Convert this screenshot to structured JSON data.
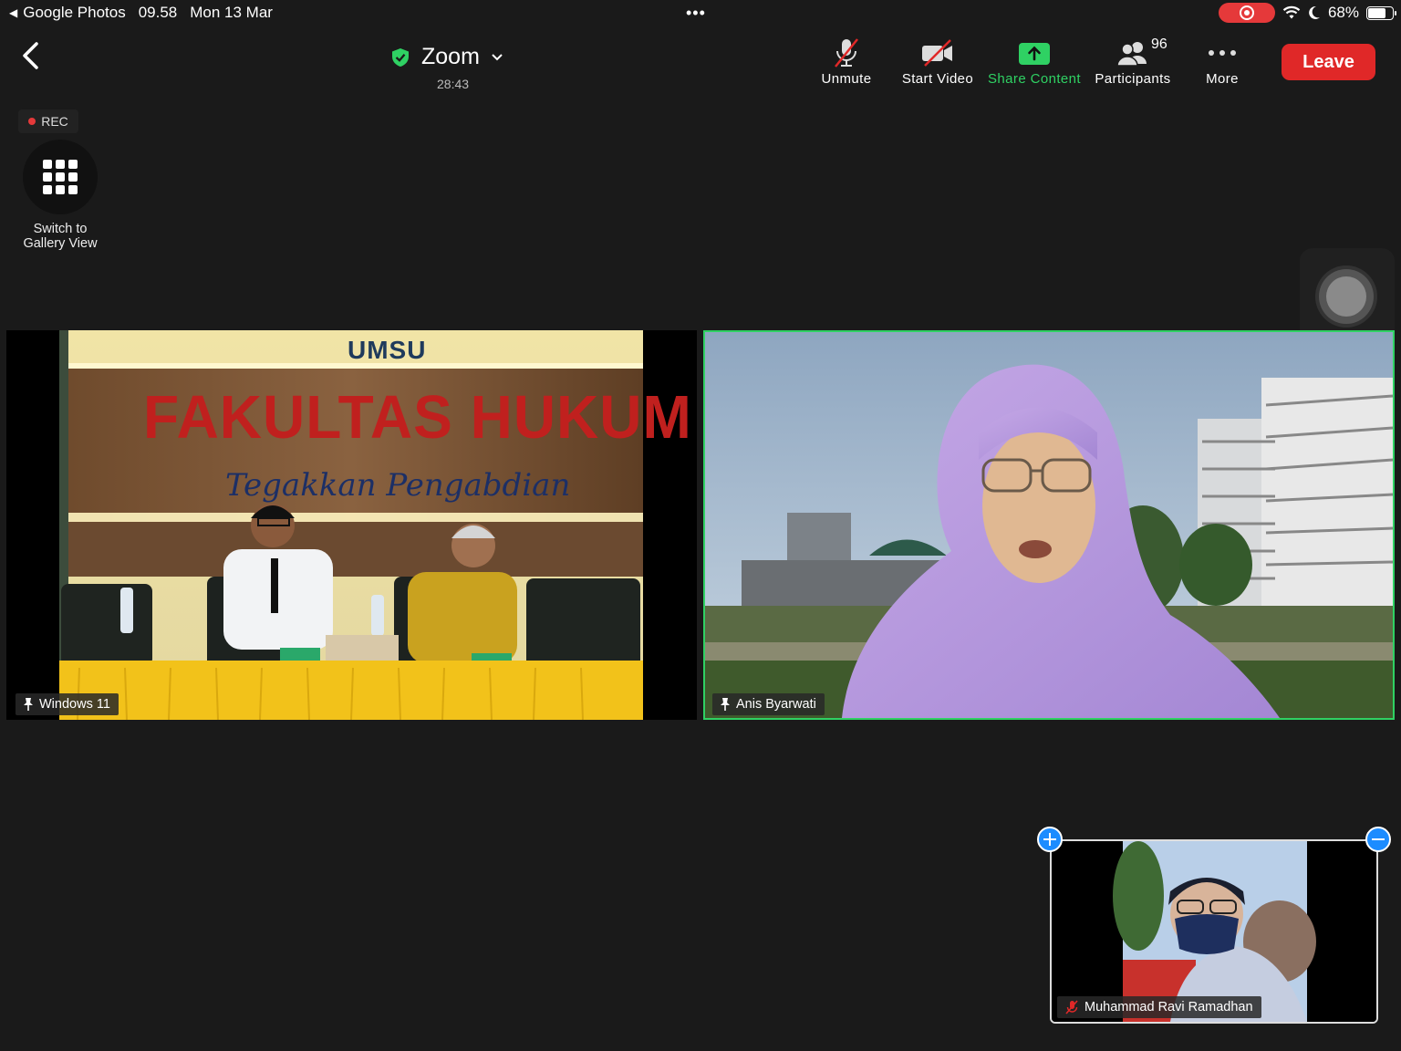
{
  "status_bar": {
    "back_app": "Google Photos",
    "time": "09.58",
    "date": "Mon 13 Mar",
    "more_dots": "•••",
    "battery": "68%"
  },
  "header": {
    "title": "Zoom",
    "elapsed": "28:43"
  },
  "toolbar": {
    "unmute": "Unmute",
    "start_video": "Start Video",
    "share_content": "Share Content",
    "participants": "Participants",
    "participants_count": "96",
    "more": "More",
    "leave": "Leave"
  },
  "recording": {
    "label": "REC"
  },
  "gallery": {
    "label": "Switch to Gallery View"
  },
  "tiles": [
    {
      "name": "Windows 11",
      "sign_top": "UMSU",
      "sign_main": "FAKULTAS HUKUM",
      "sign_script": "Tegakkan Pengabdian"
    },
    {
      "name": "Anis Byarwati"
    }
  ],
  "self_view": {
    "name": "Muhammad Ravi Ramadhan"
  },
  "colors": {
    "accent_green": "#2fd163",
    "leave_red": "#e02828",
    "rec_red": "#e5393a",
    "blue": "#1c8cff"
  }
}
